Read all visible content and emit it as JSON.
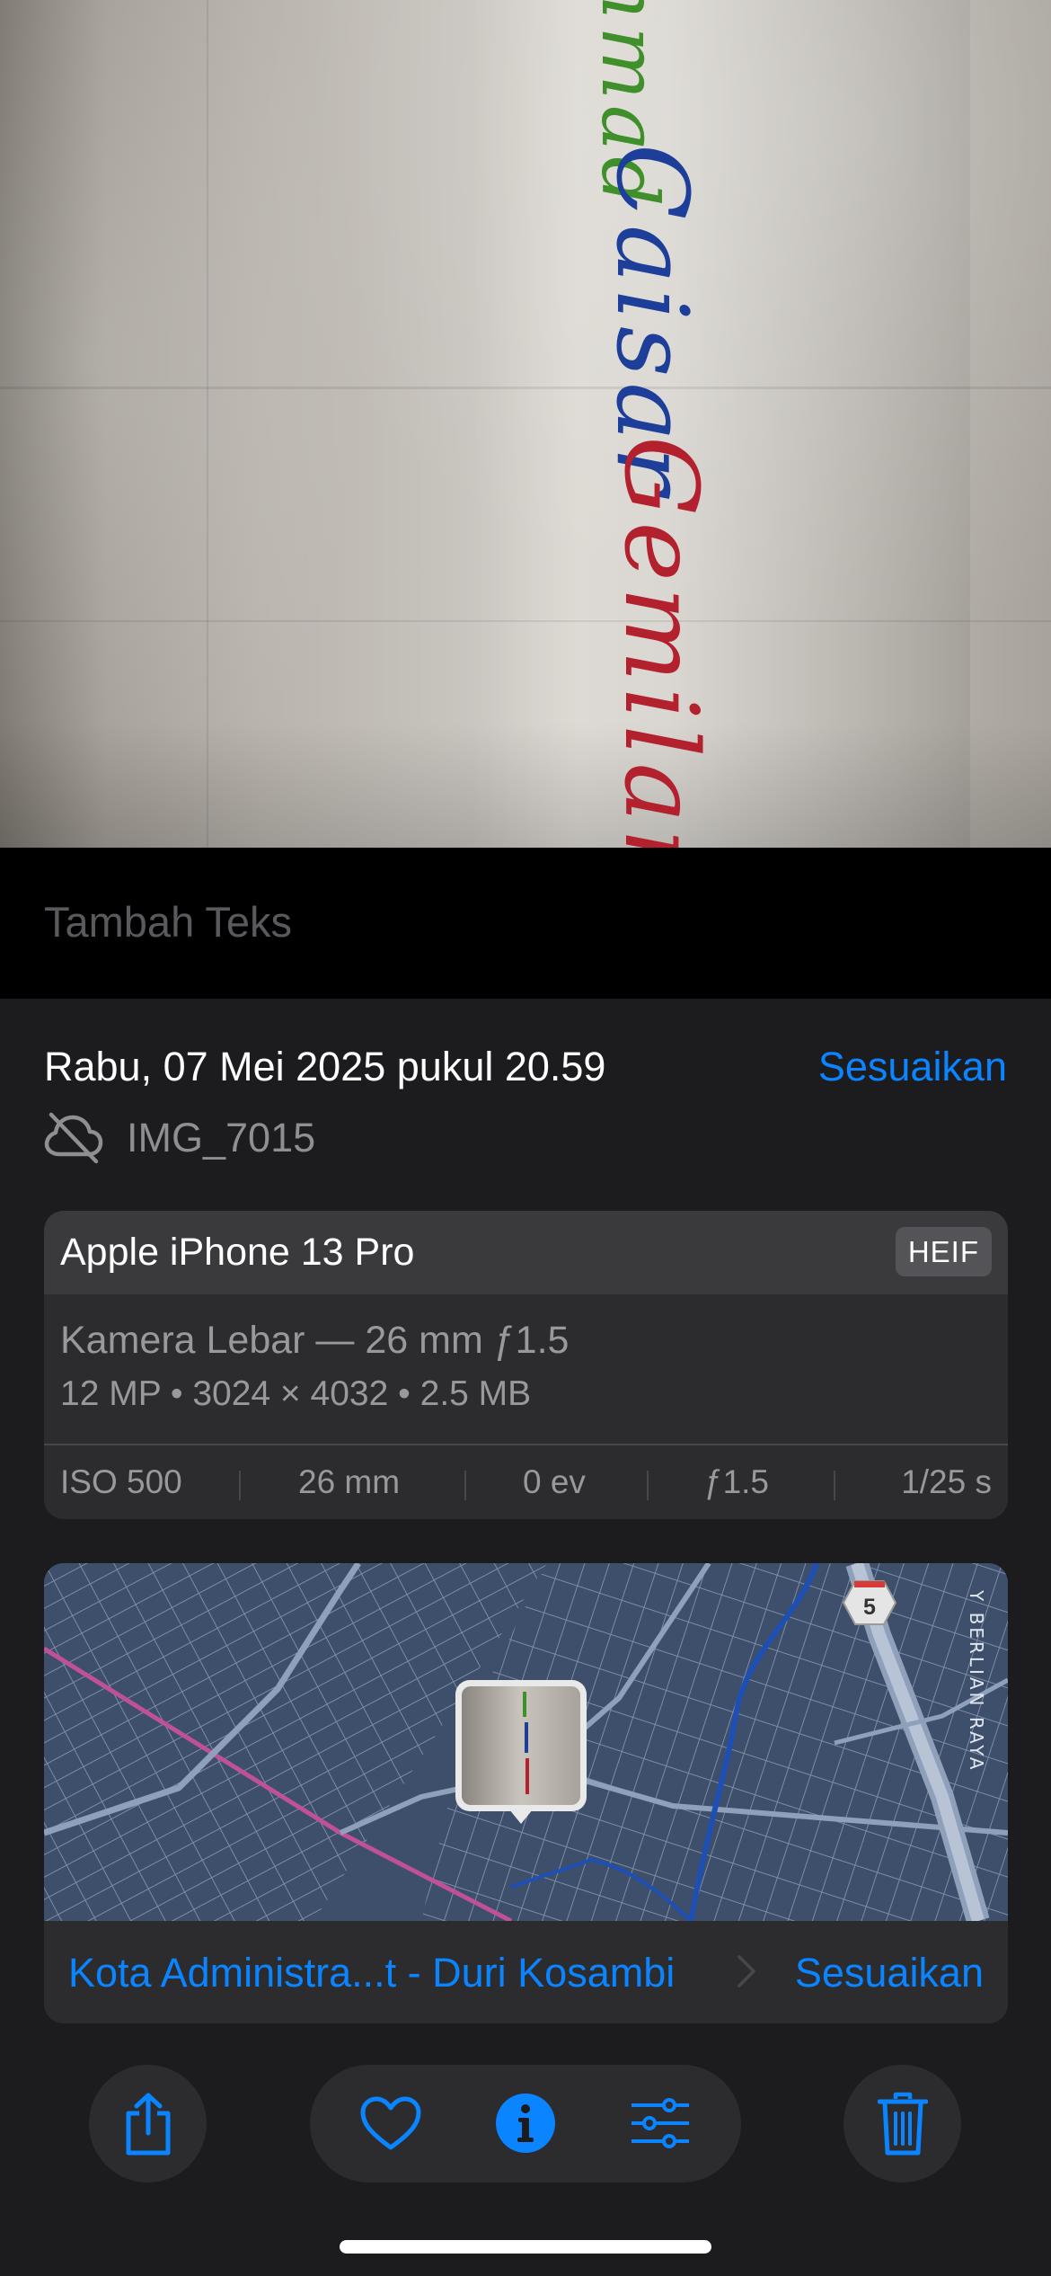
{
  "photo": {
    "handwriting": [
      "Ahmad",
      "Caisar",
      "Gemilang"
    ],
    "ink_colors": [
      "#3f8f2a",
      "#1d3f9a",
      "#b3202e"
    ]
  },
  "caption": {
    "placeholder": "Tambah Teks"
  },
  "info": {
    "datetime": "Rabu, 07 Mei 2025 pukul 20.59",
    "adjust_label": "Sesuaikan",
    "filename": "IMG_7015",
    "cloud_icon": "cloud-slash-icon"
  },
  "device": {
    "name": "Apple iPhone 13 Pro",
    "format": "HEIF",
    "lens": "Kamera Lebar — 26 mm ƒ1.5",
    "specs": "12 MP • 3024 × 4032 • 2.5 MB",
    "exif": [
      "ISO 500",
      "26 mm",
      "0 ev",
      "ƒ1.5",
      "1/25 s"
    ]
  },
  "map": {
    "location": "Kota Administra...t - Duri Kosambi",
    "adjust_label": "Sesuaikan",
    "road_shield": "5",
    "road_label": "Y BERLIAN RAYA"
  },
  "toolbar": {
    "share": "share-icon",
    "favorite": "heart-icon",
    "info": "info-icon",
    "edit": "sliders-icon",
    "delete": "trash-icon",
    "accent": "#0a84ff"
  }
}
